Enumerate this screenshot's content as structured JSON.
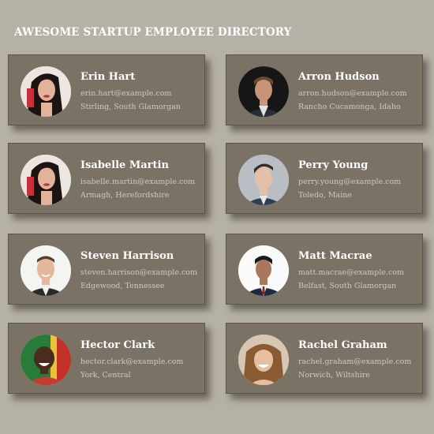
{
  "header": {
    "title": "AWESOME STARTUP EMPLOYEE DIRECTORY"
  },
  "employees": [
    {
      "name": "Erin Hart",
      "email": "erin.hart@example.com",
      "location": "Stirling, South Glamorgan"
    },
    {
      "name": "Arron Hudson",
      "email": "arron.hudson@example.com",
      "location": "Rancho Cucamonga, Idaho"
    },
    {
      "name": "Isabelle Martin",
      "email": "isabelle.martin@example.com",
      "location": "Armagh, Herefordshire"
    },
    {
      "name": "Perry Young",
      "email": "perry.young@example.com",
      "location": "Toledo, Maine"
    },
    {
      "name": "Steven Harrison",
      "email": "steven.harrison@example.com",
      "location": "Edgewood, Tennessee"
    },
    {
      "name": "Matt Macrae",
      "email": "matt.macrae@example.com",
      "location": "Belfast, South Glamorgan"
    },
    {
      "name": "Hector Clark",
      "email": "hector.clark@example.com",
      "location": "York, Central"
    },
    {
      "name": "Rachel Graham",
      "email": "rachel.graham@example.com",
      "location": "Norwich, Wiltshire"
    }
  ],
  "colors": {
    "page_background": "#b6b1a6",
    "card_background": "#7a7265",
    "name_text": "#ffffff",
    "detail_text": "#cfc9bd"
  }
}
